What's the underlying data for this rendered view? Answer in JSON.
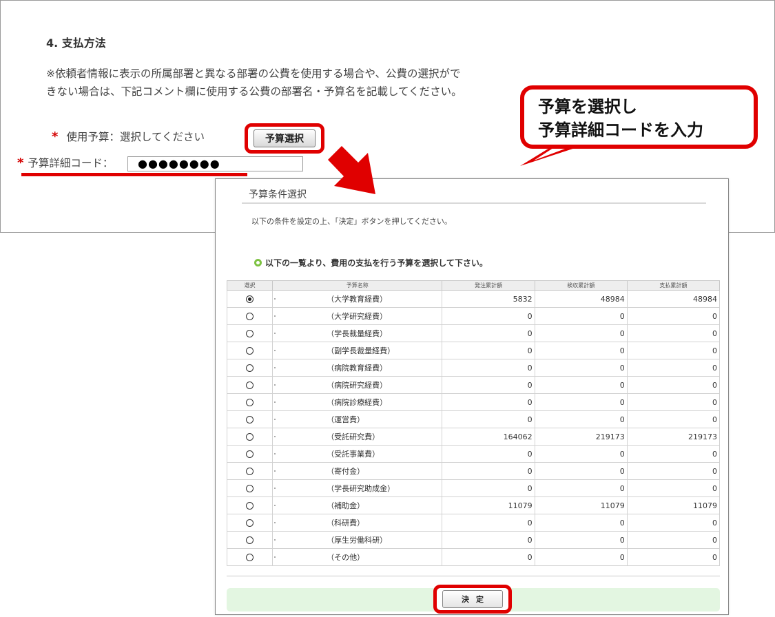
{
  "form": {
    "section_title": "4. 支払方法",
    "notice_line1": "※依頼者情報に表示の所属部署と異なる部署の公費を使用する場合や、公費の選択がで",
    "notice_line2": "きない場合は、下記コメント欄に使用する公費の部署名・予算名を記載してください。",
    "required_mark": "*",
    "budget_label": "使用予算：選択してください",
    "budget_select_button": "予算選択",
    "code_label": "予算詳細コード：",
    "code_value": "●●●●●●●●"
  },
  "callout": {
    "line1": "予算を選択し",
    "line2": "予算詳細コードを入力"
  },
  "dialog": {
    "title": "予算条件選択",
    "instruction": "以下の条件を設定の上、「決定」ボタンを押してください。",
    "subheading": "以下の一覧より、費用の支払を行う予算を選択して下さい。",
    "columns": [
      "選択",
      "予算名称",
      "発注累計額",
      "検収累計額",
      "支払累計額"
    ],
    "rows": [
      {
        "name": "（大学教育経費）",
        "ordered": "5832",
        "inspected": "48984",
        "paid": "48984",
        "selected": true
      },
      {
        "name": "（大学研究経費）",
        "ordered": "0",
        "inspected": "0",
        "paid": "0",
        "selected": false
      },
      {
        "name": "（学長裁量経費）",
        "ordered": "0",
        "inspected": "0",
        "paid": "0",
        "selected": false
      },
      {
        "name": "（副学長裁量経費）",
        "ordered": "0",
        "inspected": "0",
        "paid": "0",
        "selected": false
      },
      {
        "name": "（病院教育経費）",
        "ordered": "0",
        "inspected": "0",
        "paid": "0",
        "selected": false
      },
      {
        "name": "（病院研究経費）",
        "ordered": "0",
        "inspected": "0",
        "paid": "0",
        "selected": false
      },
      {
        "name": "（病院診療経費）",
        "ordered": "0",
        "inspected": "0",
        "paid": "0",
        "selected": false
      },
      {
        "name": "（運営費）",
        "ordered": "0",
        "inspected": "0",
        "paid": "0",
        "selected": false
      },
      {
        "name": "（受託研究費）",
        "ordered": "164062",
        "inspected": "219173",
        "paid": "219173",
        "selected": false
      },
      {
        "name": "（受託事業費）",
        "ordered": "0",
        "inspected": "0",
        "paid": "0",
        "selected": false
      },
      {
        "name": "（寄付金）",
        "ordered": "0",
        "inspected": "0",
        "paid": "0",
        "selected": false
      },
      {
        "name": "（学長研究助成金）",
        "ordered": "0",
        "inspected": "0",
        "paid": "0",
        "selected": false
      },
      {
        "name": "（補助金）",
        "ordered": "11079",
        "inspected": "11079",
        "paid": "11079",
        "selected": false
      },
      {
        "name": "（科研費）",
        "ordered": "0",
        "inspected": "0",
        "paid": "0",
        "selected": false
      },
      {
        "name": "（厚生労働科研）",
        "ordered": "0",
        "inspected": "0",
        "paid": "0",
        "selected": false
      },
      {
        "name": "（その他）",
        "ordered": "0",
        "inspected": "0",
        "paid": "0",
        "selected": false
      }
    ],
    "decide_button": "決定"
  },
  "colors": {
    "highlight_red": "#e00000",
    "decide_bar_green": "#e3f6e1",
    "bullet_green": "#7dc242"
  }
}
